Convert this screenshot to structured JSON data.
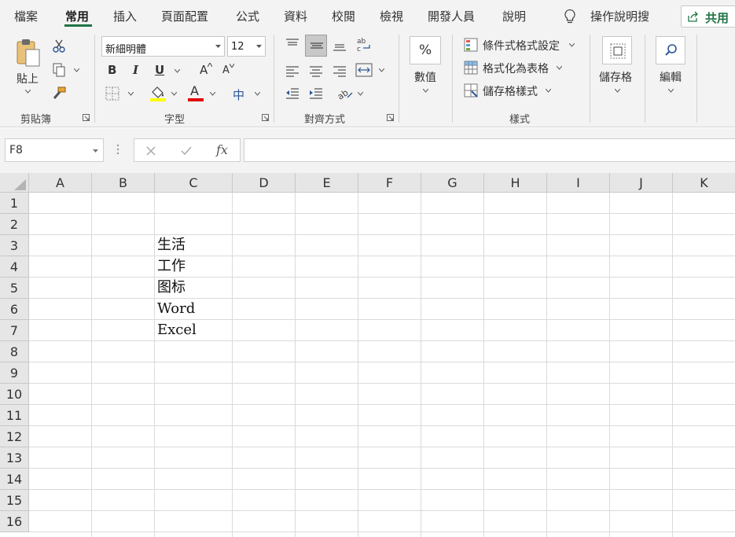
{
  "menu": {
    "tabs": [
      "檔案",
      "常用",
      "插入",
      "頁面配置",
      "公式",
      "資料",
      "校閱",
      "檢視",
      "開發人員",
      "說明"
    ],
    "active_tab": "常用",
    "tell_me": "操作說明搜",
    "share": "共用"
  },
  "ribbon": {
    "clipboard": {
      "paste": "貼上",
      "label": "剪貼簿"
    },
    "font": {
      "name": "新細明體",
      "size": "12",
      "bold": "B",
      "italic": "I",
      "underline": "U",
      "grow": "A",
      "shrink": "A",
      "font_color_letter": "A",
      "phonetic": "中",
      "label": "字型"
    },
    "alignment": {
      "label": "對齊方式"
    },
    "number": {
      "symbol": "%",
      "label": "數值"
    },
    "styles": {
      "conditional": "條件式格式設定",
      "format_table": "格式化為表格",
      "cell_styles": "儲存格樣式",
      "label": "樣式"
    },
    "cells": {
      "label": "儲存格"
    },
    "editing": {
      "label": "編輯"
    }
  },
  "formula_bar": {
    "name_box": "F8",
    "fx": "fx",
    "value": ""
  },
  "sheet": {
    "columns": [
      "A",
      "B",
      "C",
      "D",
      "E",
      "F",
      "G",
      "H",
      "I",
      "J",
      "K"
    ],
    "rows": [
      "1",
      "2",
      "3",
      "4",
      "5",
      "6",
      "7",
      "8",
      "9",
      "10",
      "11",
      "12",
      "13",
      "14",
      "15",
      "16"
    ],
    "cells": {
      "C3": "生活",
      "C4": "工作",
      "C5": "图标",
      "C6": "Word",
      "C7": "Excel"
    }
  },
  "colors": {
    "accent": "#217346",
    "highlight": "#ffff00",
    "font_color": "#e00000"
  }
}
